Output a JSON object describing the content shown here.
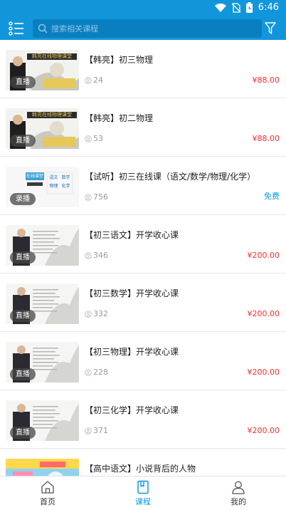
{
  "status": {
    "time": "6:46"
  },
  "search": {
    "placeholder": "搜索相关课程"
  },
  "courses": [
    {
      "title": "【韩亮】初三物理",
      "count": "24",
      "price": "¥88.00",
      "badge": "直播",
      "thumb_style": "han"
    },
    {
      "title": "【韩亮】初二物理",
      "count": "53",
      "price": "¥88.00",
      "badge": "直播",
      "thumb_style": "han"
    },
    {
      "title": "【试听】初三在线课（语文/数学/物理/化学）",
      "count": "756",
      "price": "免费",
      "badge": "录播",
      "thumb_style": "online"
    },
    {
      "title": "【初三语文】开学收心课",
      "count": "346",
      "price": "¥200.00",
      "badge": "直播",
      "thumb_style": "teacher"
    },
    {
      "title": "【初三数学】开学收心课",
      "count": "332",
      "price": "¥200.00",
      "badge": "直播",
      "thumb_style": "teacher"
    },
    {
      "title": "【初三物理】开学收心课",
      "count": "228",
      "price": "¥200.00",
      "badge": "直播",
      "thumb_style": "teacher"
    },
    {
      "title": "【初三化学】开学收心课",
      "count": "371",
      "price": "¥200.00",
      "badge": "直播",
      "thumb_style": "teacher"
    },
    {
      "title": "【高中语文】小说背后的人物",
      "count": "",
      "price": "",
      "badge": "",
      "thumb_style": "colorful"
    }
  ],
  "thumbs": {
    "han_heading": "韩亮在线物理课堂",
    "online_heading": "在线课堂",
    "online_subjects": [
      "语文",
      "数学",
      "物理",
      "化学"
    ]
  },
  "tabs": [
    {
      "label": "首页",
      "icon": "home-icon",
      "active": false
    },
    {
      "label": "课程",
      "icon": "book-icon",
      "active": true
    },
    {
      "label": "我的",
      "icon": "user-icon",
      "active": false
    }
  ],
  "colors": {
    "primary": "#1296db",
    "price": "#f23030"
  }
}
